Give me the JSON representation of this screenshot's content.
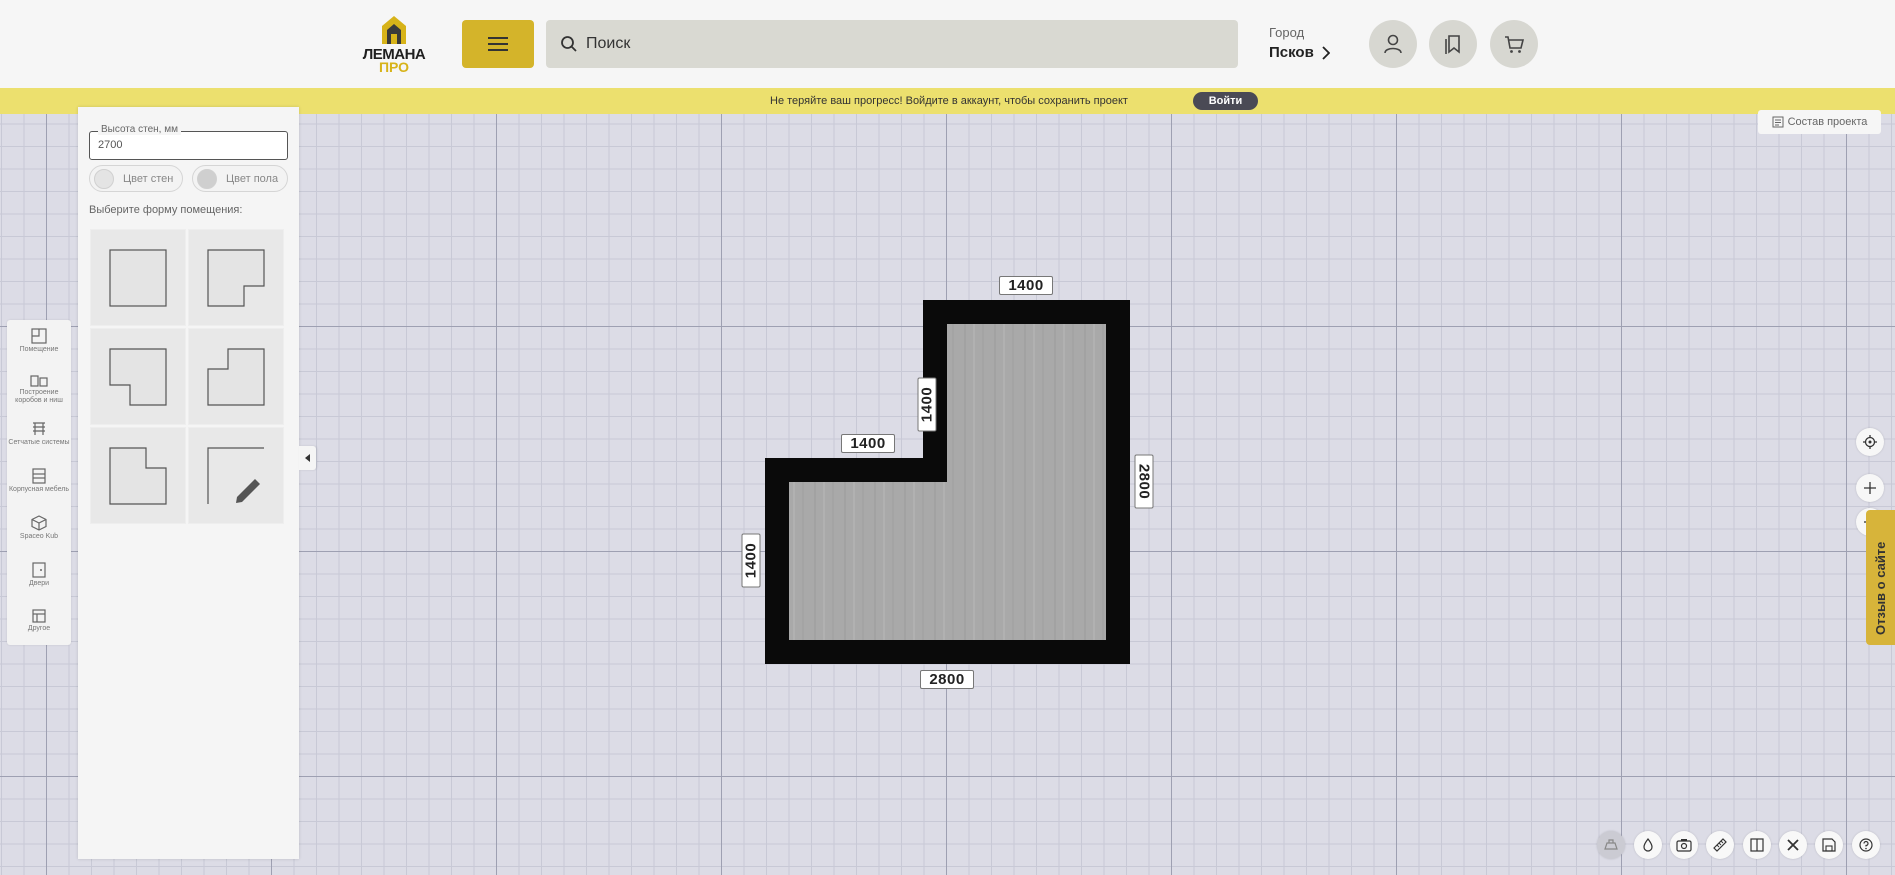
{
  "header": {
    "logo_line1": "ЛЕМАНА",
    "logo_line2": "ПРО",
    "search_placeholder": "Поиск",
    "city_label": "Город",
    "city_name": "Псков"
  },
  "banner": {
    "text": "Не теряйте ваш прогресс! Войдите в аккаунт, чтобы сохранить проект",
    "login_label": "Войти"
  },
  "left_toolbar": {
    "items": [
      {
        "label": "Помещение",
        "icon": "room-icon"
      },
      {
        "label": "Построение коробов и ниш",
        "icon": "boxes-icon"
      },
      {
        "label": "Сетчатые системы",
        "icon": "mesh-system-icon"
      },
      {
        "label": "Корпусная мебель",
        "icon": "cabinet-icon"
      },
      {
        "label": "Spaceo Kub",
        "icon": "cube-icon"
      },
      {
        "label": "Двери",
        "icon": "door-icon"
      },
      {
        "label": "Другое",
        "icon": "other-icon"
      }
    ]
  },
  "panel": {
    "wall_height_label": "Высота стен, мм",
    "wall_height_value": "2700",
    "wall_color_label": "Цвет стен",
    "floor_color_label": "Цвет пола",
    "shape_title": "Выберите форму помещения:",
    "shapes": [
      "rectangle",
      "l-shape-bottom-right",
      "l-shape-bottom-left",
      "l-shape-top-left",
      "l-shape-top-right",
      "custom-draw"
    ]
  },
  "plan": {
    "dimensions": {
      "top": "1400",
      "inner_vertical": "1400",
      "inner_horizontal": "1400",
      "right": "2800",
      "left": "1400",
      "bottom": "2800"
    },
    "wall_color": "#0a0a0a",
    "floor_color": "#a9a9a9"
  },
  "right": {
    "project_label": "Состав проекта",
    "feedback_label": "Отзыв о сайте"
  },
  "bottom_toolbar": {
    "items": [
      "3d-view-icon",
      "dropper-icon",
      "screenshot-icon",
      "ruler-icon",
      "door-frame-icon",
      "tools-icon",
      "save-icon",
      "help-icon"
    ]
  },
  "colors": {
    "accent": "#d4b42a",
    "banner": "#ece06e",
    "canvas": "#dcdce6"
  }
}
